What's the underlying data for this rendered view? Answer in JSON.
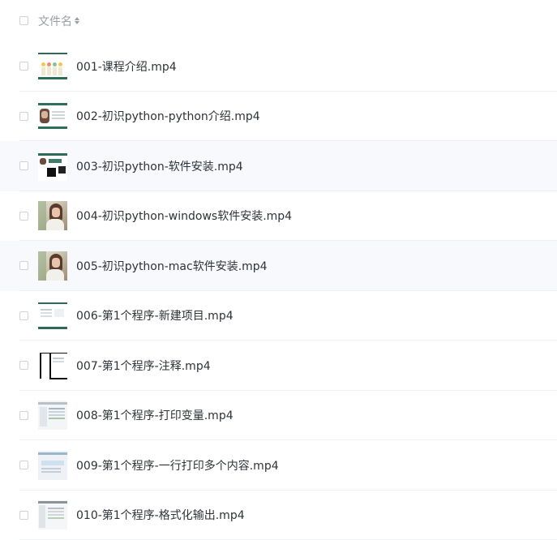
{
  "header": {
    "column_label": "文件名",
    "sort_icon": "sort-icon"
  },
  "files": [
    {
      "name": "001-课程介绍.mp4",
      "thumbnail": "slides-thumbnail"
    },
    {
      "name": "002-初识python-python介绍.mp4",
      "thumbnail": "presenter-thumbnail"
    },
    {
      "name": "003-初识python-软件安装.mp4",
      "thumbnail": "install-thumbnail"
    },
    {
      "name": "004-初识python-windows软件安装.mp4",
      "thumbnail": "photo-thumbnail"
    },
    {
      "name": "005-初识python-mac软件安装.mp4",
      "thumbnail": "photo-thumbnail"
    },
    {
      "name": "006-第1个程序-新建项目.mp4",
      "thumbnail": "document-thumbnail"
    },
    {
      "name": "007-第1个程序-注释.mp4",
      "thumbnail": "frame-thumbnail"
    },
    {
      "name": "008-第1个程序-打印变量.mp4",
      "thumbnail": "screen-thumbnail"
    },
    {
      "name": "009-第1个程序-一行打印多个内容.mp4",
      "thumbnail": "screen-thumbnail"
    },
    {
      "name": "010-第1个程序-格式化输出.mp4",
      "thumbnail": "screen-thumbnail"
    }
  ],
  "colors": {
    "row_shade": "#f7f9fc",
    "divider": "#eef0f3",
    "header_text": "#9a9ea6",
    "file_text": "#2f3237"
  }
}
